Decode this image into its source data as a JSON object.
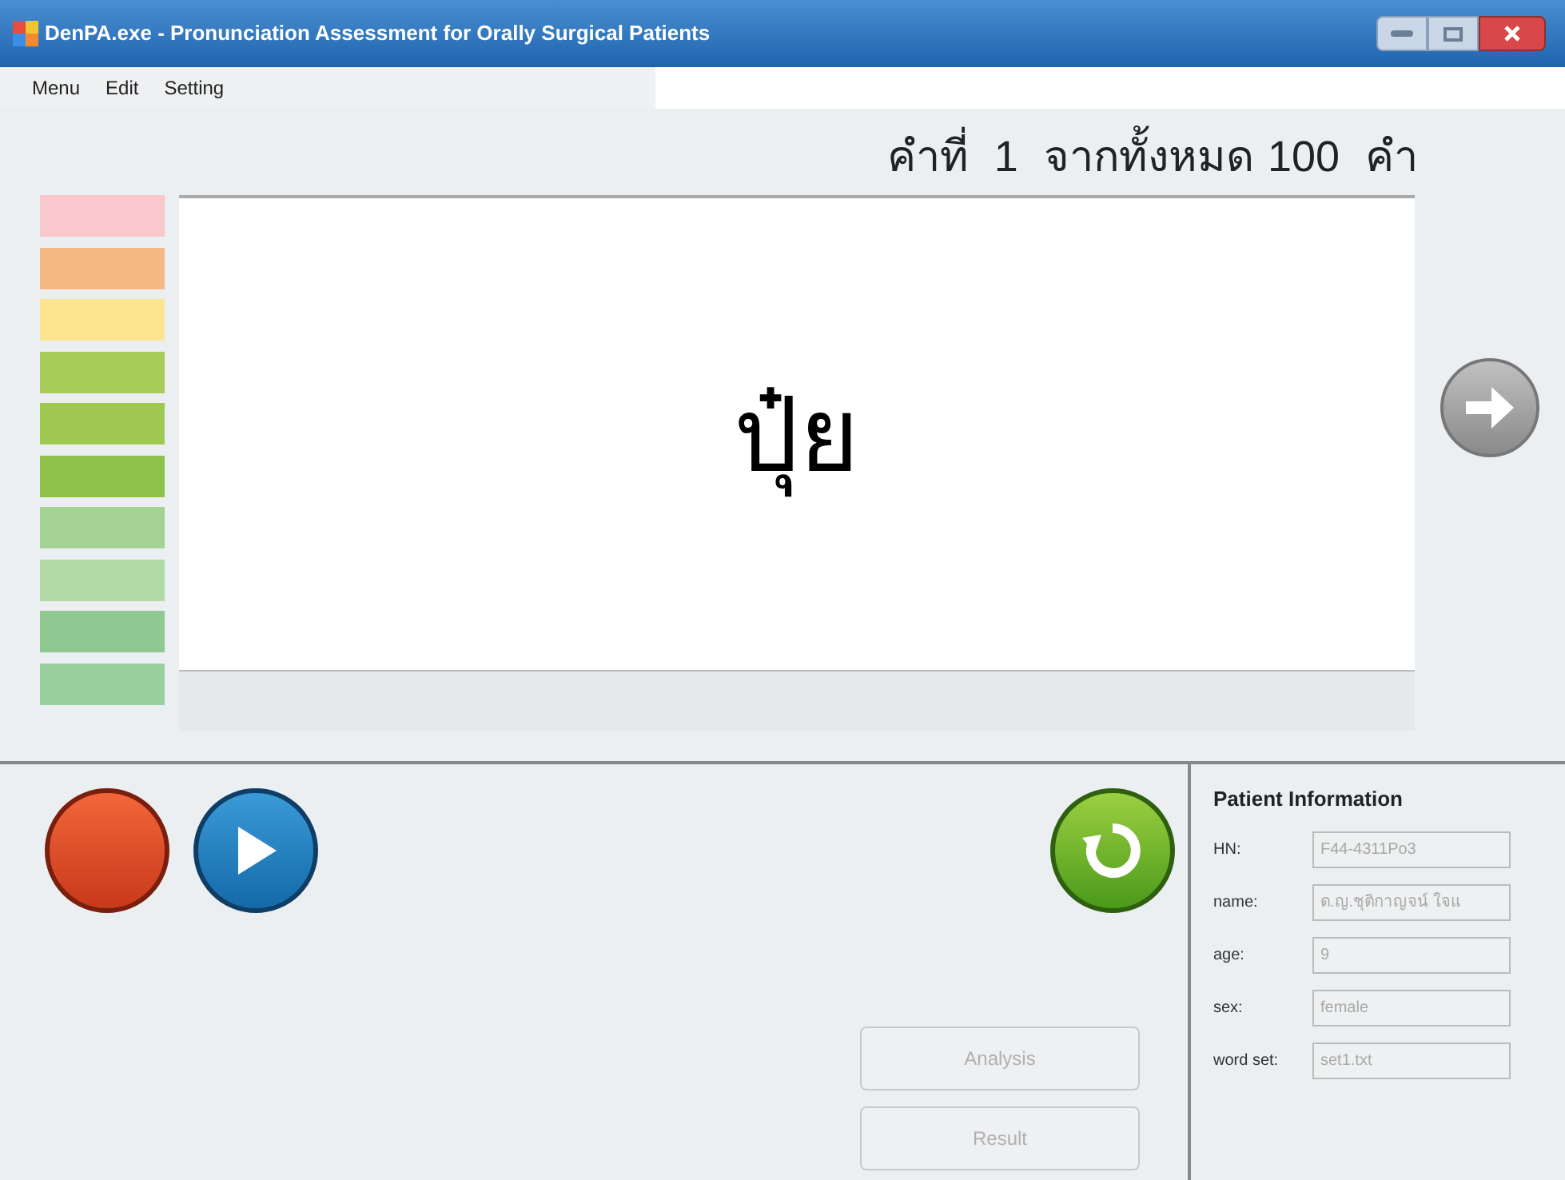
{
  "window": {
    "title": "DenPA.exe - Pronunciation Assessment for Orally Surgical Patients"
  },
  "menu": [
    "Menu",
    "Edit",
    "Setting"
  ],
  "counter": {
    "label": "คำที่",
    "current": "1",
    "of": "จากทั้งหมด",
    "total": "100",
    "unit": "คำ"
  },
  "levels": [
    {
      "color": "#f8c8cc"
    },
    {
      "color": "#f6b884"
    },
    {
      "color": "#fce58e"
    },
    {
      "color": "#a8cc58"
    },
    {
      "color": "#9ec850"
    },
    {
      "color": "#8ec24a"
    },
    {
      "color": "#a4d294"
    },
    {
      "color": "#b2daa6"
    },
    {
      "color": "#8fc890"
    },
    {
      "color": "#98cf9c"
    }
  ],
  "word": "ปุ๋ย",
  "actions": [
    {
      "label": "Analysis",
      "disabled": true
    },
    {
      "label": "Result",
      "disabled": true
    }
  ],
  "patient": {
    "title": "Patient Information",
    "fields": [
      {
        "label": "HN:",
        "value": "F44-4311Po3"
      },
      {
        "label": "name:",
        "value": "ด.ญ.ชุติกาญจน์ ใจแ"
      },
      {
        "label": "age:",
        "value": "9"
      },
      {
        "label": "sex:",
        "value": "female"
      },
      {
        "label": "word set:",
        "value": "set1.txt"
      }
    ]
  }
}
